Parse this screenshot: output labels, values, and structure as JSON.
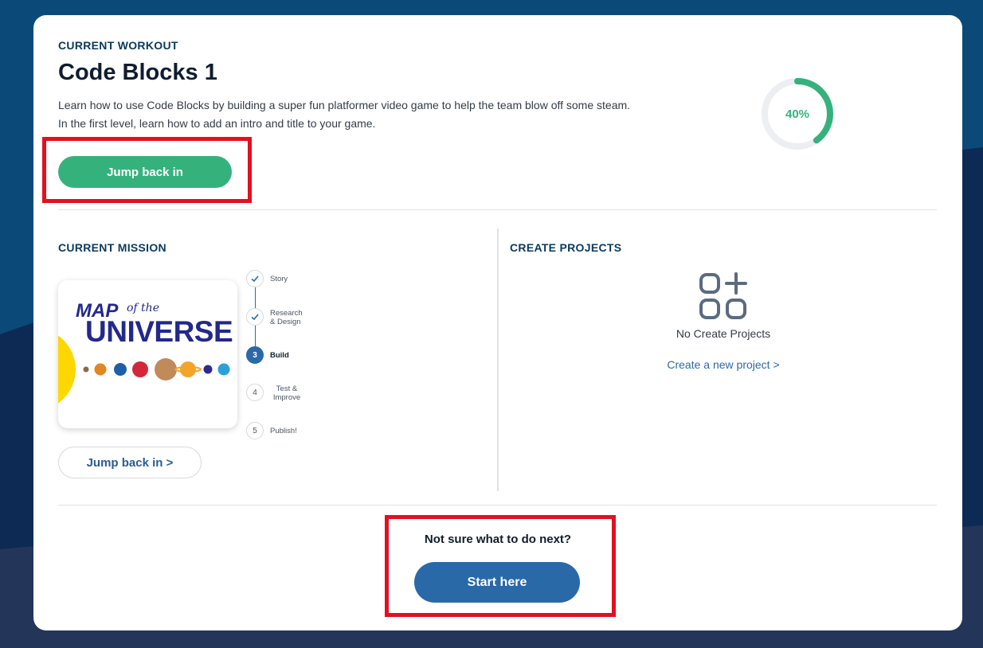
{
  "workout": {
    "eyebrow": "CURRENT WORKOUT",
    "title": "Code Blocks 1",
    "description": "Learn how to use Code Blocks by building a super fun platformer video game to help the team blow off some steam. In the first level, learn how to add an intro and title to your game.",
    "jump_back_label": "Jump back in",
    "progress_label": "40%",
    "progress_fraction": 0.4
  },
  "mission": {
    "eyebrow": "CURRENT MISSION",
    "image_title_1": "MAP",
    "image_title_2": "of the",
    "image_title_3": "UNIVERSE",
    "jump_back_label": "Jump back in >",
    "steps": [
      {
        "number": "1",
        "label": "Story",
        "status": "done"
      },
      {
        "number": "2",
        "label": "Research & Design",
        "status": "done"
      },
      {
        "number": "3",
        "label": "Build",
        "status": "current"
      },
      {
        "number": "4",
        "label": "Test & Improve",
        "status": "todo"
      },
      {
        "number": "5",
        "label": "Publish!",
        "status": "todo"
      }
    ]
  },
  "projects": {
    "eyebrow": "CREATE PROJECTS",
    "empty_label": "No Create Projects",
    "new_project_label": "Create a new project >"
  },
  "next": {
    "question": "Not sure what to do next?",
    "start_label": "Start here"
  },
  "colors": {
    "accent_green": "#35b27c",
    "accent_blue": "#2a69a8",
    "highlight_red": "#e3101f",
    "navy_text": "#0b3a5c"
  }
}
